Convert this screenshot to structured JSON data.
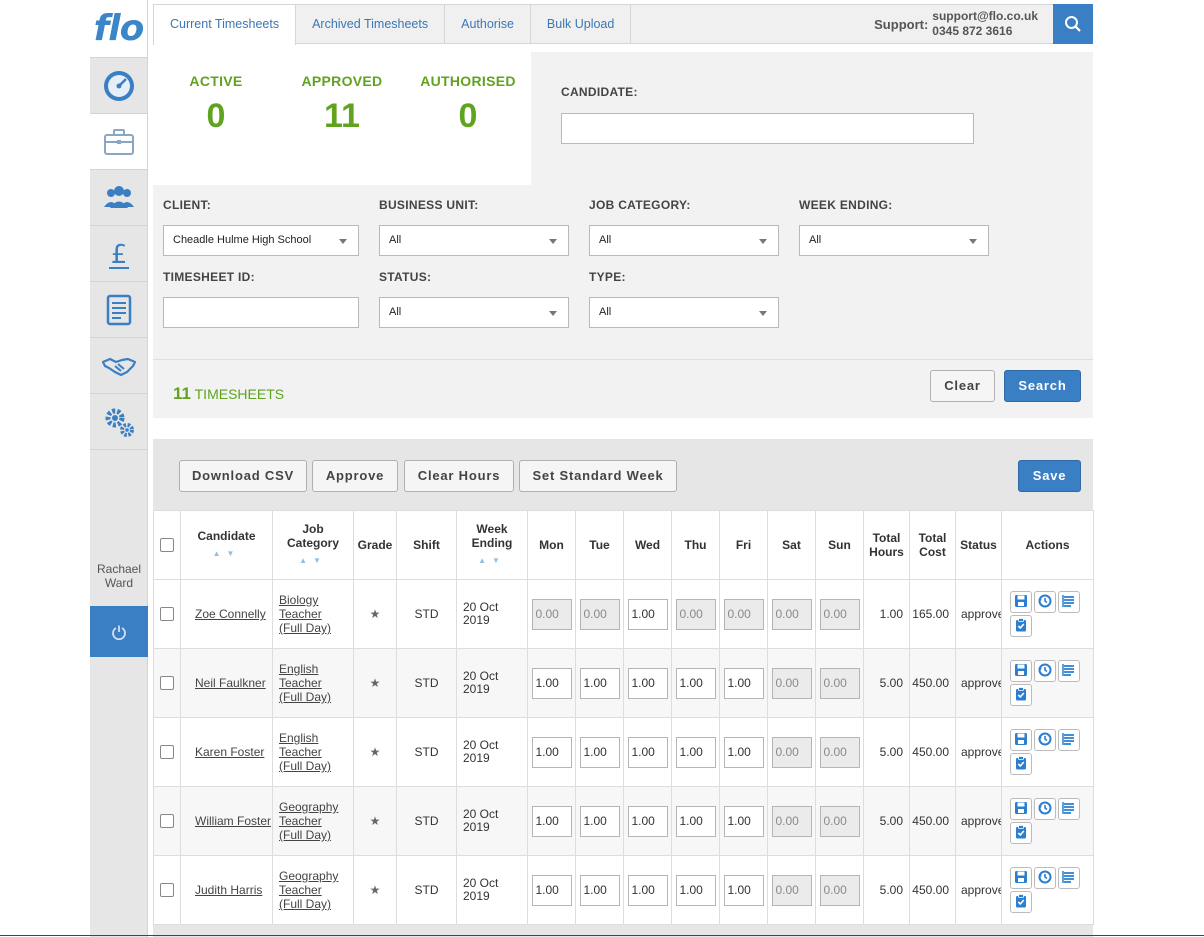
{
  "app": {
    "logo_text": "flo",
    "brand_color": "#3a7ec3",
    "accent_green": "#5fa31e"
  },
  "sidebar": {
    "items": [
      {
        "icon": "dashboard-icon",
        "active": false
      },
      {
        "icon": "briefcase-icon",
        "active": true
      },
      {
        "icon": "people-icon",
        "active": false
      },
      {
        "icon": "pound-icon",
        "active": false
      },
      {
        "icon": "document-icon",
        "active": false
      },
      {
        "icon": "handshake-icon",
        "active": false
      },
      {
        "icon": "settings-icon",
        "active": false
      }
    ],
    "user_first": "Rachael",
    "user_last": "Ward"
  },
  "tabs": [
    "Current Timesheets",
    "Archived Timesheets",
    "Authorise",
    "Bulk Upload"
  ],
  "support": {
    "label": "Support:",
    "email": "support@flo.co.uk",
    "phone": "0345 872 3616"
  },
  "counts": [
    {
      "label": "ACTIVE",
      "value": "0"
    },
    {
      "label": "APPROVED",
      "value": "11"
    },
    {
      "label": "AUTHORISED",
      "value": "0"
    }
  ],
  "filters": {
    "candidate_label": "CANDIDATE:",
    "candidate_value": "",
    "client_label": "CLIENT:",
    "client_value": "Cheadle Hulme High School",
    "business_unit_label": "BUSINESS UNIT:",
    "business_unit_value": "All",
    "job_category_label": "JOB CATEGORY:",
    "job_category_value": "All",
    "week_ending_label": "WEEK ENDING:",
    "week_ending_value": "All",
    "timesheet_id_label": "TIMESHEET ID:",
    "timesheet_id_value": "",
    "status_label": "STATUS:",
    "status_value": "All",
    "type_label": "TYPE:",
    "type_value": "All"
  },
  "results": {
    "count": "11",
    "label": "TIMESHEETS",
    "clear_label": "Clear",
    "search_label": "Search"
  },
  "toolbar": {
    "download_csv": "Download CSV",
    "approve": "Approve",
    "clear_hours": "Clear Hours",
    "set_standard_week": "Set Standard Week",
    "save": "Save"
  },
  "table": {
    "headers": {
      "candidate": "Candidate",
      "job_category_1": "Job",
      "job_category_2": "Category",
      "grade": "Grade",
      "shift": "Shift",
      "week_ending_1": "Week",
      "week_ending_2": "Ending",
      "mon": "Mon",
      "tue": "Tue",
      "wed": "Wed",
      "thu": "Thu",
      "fri": "Fri",
      "sat": "Sat",
      "sun": "Sun",
      "total_hours_1": "Total",
      "total_hours_2": "Hours",
      "total_cost_1": "Total",
      "total_cost_2": "Cost",
      "status": "Status",
      "actions": "Actions"
    },
    "rows": [
      {
        "candidate": "Zoe Connelly",
        "job": [
          "Biology",
          "Teacher",
          "(Full Day)"
        ],
        "shift": "STD",
        "week": [
          "20 Oct",
          "2019"
        ],
        "days": [
          {
            "v": "0.00",
            "disabled": true
          },
          {
            "v": "0.00",
            "disabled": true
          },
          {
            "v": "1.00",
            "disabled": false
          },
          {
            "v": "0.00",
            "disabled": true
          },
          {
            "v": "0.00",
            "disabled": true
          },
          {
            "v": "0.00",
            "disabled": true
          },
          {
            "v": "0.00",
            "disabled": true
          }
        ],
        "total_hours": "1.00",
        "total_cost": "165.00",
        "status": "approved"
      },
      {
        "candidate": "Neil Faulkner",
        "job": [
          "English",
          "Teacher",
          "(Full Day)"
        ],
        "shift": "STD",
        "week": [
          "20 Oct",
          "2019"
        ],
        "days": [
          {
            "v": "1.00",
            "disabled": false
          },
          {
            "v": "1.00",
            "disabled": false
          },
          {
            "v": "1.00",
            "disabled": false
          },
          {
            "v": "1.00",
            "disabled": false
          },
          {
            "v": "1.00",
            "disabled": false
          },
          {
            "v": "0.00",
            "disabled": true
          },
          {
            "v": "0.00",
            "disabled": true
          }
        ],
        "total_hours": "5.00",
        "total_cost": "450.00",
        "status": "approved"
      },
      {
        "candidate": "Karen Foster",
        "job": [
          "English",
          "Teacher",
          "(Full Day)"
        ],
        "shift": "STD",
        "week": [
          "20 Oct",
          "2019"
        ],
        "days": [
          {
            "v": "1.00",
            "disabled": false
          },
          {
            "v": "1.00",
            "disabled": false
          },
          {
            "v": "1.00",
            "disabled": false
          },
          {
            "v": "1.00",
            "disabled": false
          },
          {
            "v": "1.00",
            "disabled": false
          },
          {
            "v": "0.00",
            "disabled": true
          },
          {
            "v": "0.00",
            "disabled": true
          }
        ],
        "total_hours": "5.00",
        "total_cost": "450.00",
        "status": "approved"
      },
      {
        "candidate": "William Foster",
        "job": [
          "Geography",
          "Teacher",
          "(Full Day)"
        ],
        "shift": "STD",
        "week": [
          "20 Oct",
          "2019"
        ],
        "days": [
          {
            "v": "1.00",
            "disabled": false
          },
          {
            "v": "1.00",
            "disabled": false
          },
          {
            "v": "1.00",
            "disabled": false
          },
          {
            "v": "1.00",
            "disabled": false
          },
          {
            "v": "1.00",
            "disabled": false
          },
          {
            "v": "0.00",
            "disabled": true
          },
          {
            "v": "0.00",
            "disabled": true
          }
        ],
        "total_hours": "5.00",
        "total_cost": "450.00",
        "status": "approved"
      },
      {
        "candidate": "Judith Harris",
        "job": [
          "Geography",
          "Teacher",
          "(Full Day)"
        ],
        "shift": "STD",
        "week": [
          "20 Oct",
          "2019"
        ],
        "days": [
          {
            "v": "1.00",
            "disabled": false
          },
          {
            "v": "1.00",
            "disabled": false
          },
          {
            "v": "1.00",
            "disabled": false
          },
          {
            "v": "1.00",
            "disabled": false
          },
          {
            "v": "1.00",
            "disabled": false
          },
          {
            "v": "0.00",
            "disabled": true
          },
          {
            "v": "0.00",
            "disabled": true
          }
        ],
        "total_hours": "5.00",
        "total_cost": "450.00",
        "status": "approved"
      }
    ]
  }
}
